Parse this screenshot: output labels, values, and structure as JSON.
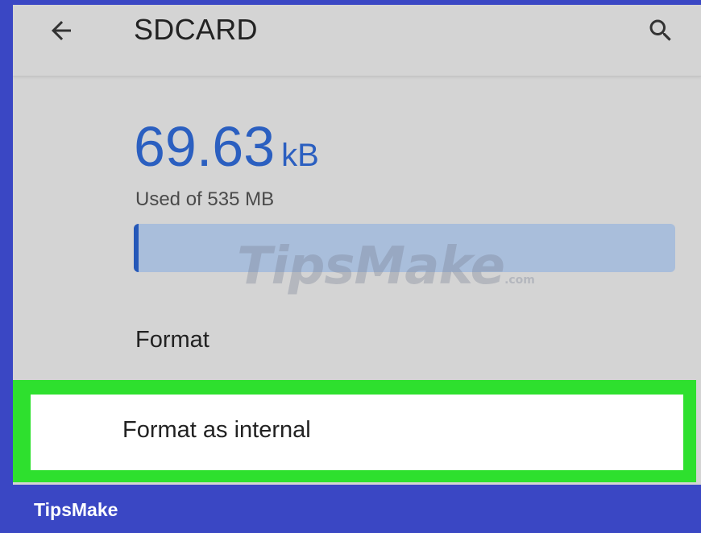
{
  "header": {
    "title": "SDCARD",
    "back_icon": "arrow-left-icon",
    "search_icon": "search-icon"
  },
  "storage": {
    "used_value": "69.63",
    "used_unit": "kB",
    "caption": "Used of 535 MB",
    "used_fraction": 0.00013,
    "bar_color": "#a9bedb",
    "fill_color": "#2558b8"
  },
  "menu": {
    "format_label": "Format",
    "format_internal_label": "Format as internal"
  },
  "watermark": {
    "text": "TipsMake",
    "suffix": ".com"
  },
  "footer": {
    "brand": "TipsMake"
  },
  "colors": {
    "accent": "#2b5fc0",
    "highlight": "#2ee02e",
    "frame": "#3a47c4"
  }
}
